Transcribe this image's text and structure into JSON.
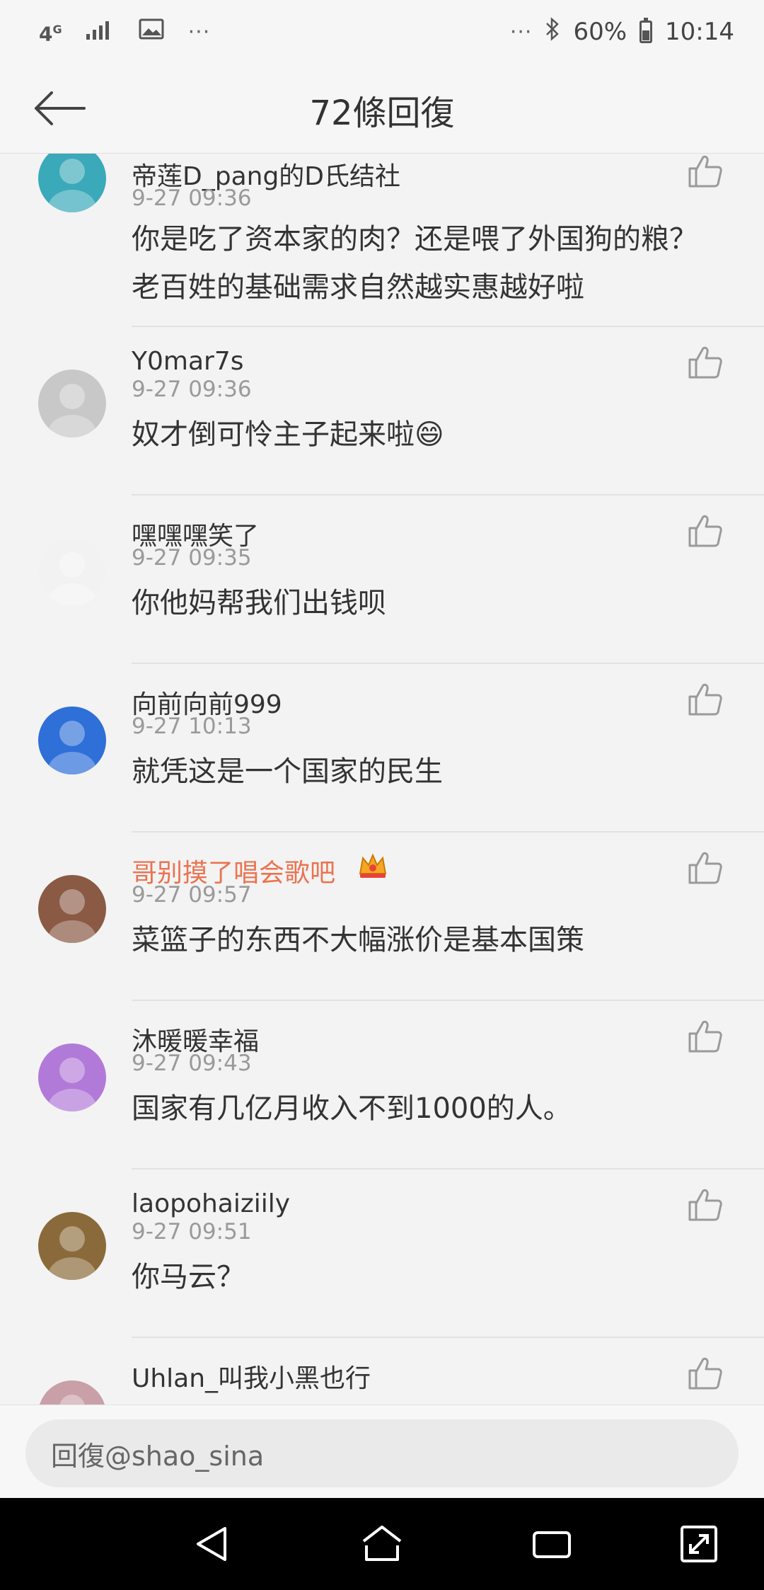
{
  "status_bar": {
    "network": "4G",
    "more": "···",
    "more_right": "···",
    "battery": "60%",
    "time": "10:14"
  },
  "header": {
    "title": "72條回復",
    "back_icon": "back-arrow-icon"
  },
  "comments": [
    {
      "username": "帝莲D_pang的D氏结社",
      "timestamp": "9-27 09:36",
      "lines": [
        "你是吃了资本家的肉？还是喂了外国狗的粮？",
        "老百姓的基础需求自然越实惠越好啦"
      ],
      "avatar_color": "#3aa9b9"
    },
    {
      "username": "Y0mar7s",
      "timestamp": "9-27 09:36",
      "lines": [
        "奴才倒可怜主子起来啦😄"
      ],
      "avatar_color": "#c8c8c8"
    },
    {
      "username": "嘿嘿嘿笑了",
      "timestamp": "9-27 09:35",
      "lines": [
        "你他妈帮我们出钱呗"
      ],
      "avatar_color": "#f2f2f2"
    },
    {
      "username": "向前向前999",
      "timestamp": "9-27 10:13",
      "lines": [
        "就凭这是一个国家的民生"
      ],
      "avatar_color": "#2f6fd8"
    },
    {
      "username": "哥别摸了唱会歌吧",
      "timestamp": "9-27 09:57",
      "lines": [
        "菜篮子的东西不大幅涨价是基本国策"
      ],
      "avatar_color": "#8a5a44",
      "vip": true
    },
    {
      "username": "沐暖暖幸福",
      "timestamp": "9-27 09:43",
      "lines": [
        "国家有几亿月收入不到1000的人。"
      ],
      "avatar_color": "#b27ad8"
    },
    {
      "username": "laopohaiziily",
      "timestamp": "9-27 09:51",
      "lines": [
        "你马云？"
      ],
      "avatar_color": "#8a6a3a"
    },
    {
      "username": "Uhlan_叫我小黑也行",
      "timestamp": "",
      "lines": [],
      "avatar_color": "#c9a0a8"
    }
  ],
  "reply": {
    "placeholder": "回復@shao_sina"
  },
  "colors": {
    "vip_name": "#eb7350",
    "timestamp": "#9a9a9a",
    "icon": "#9a9a9a"
  }
}
